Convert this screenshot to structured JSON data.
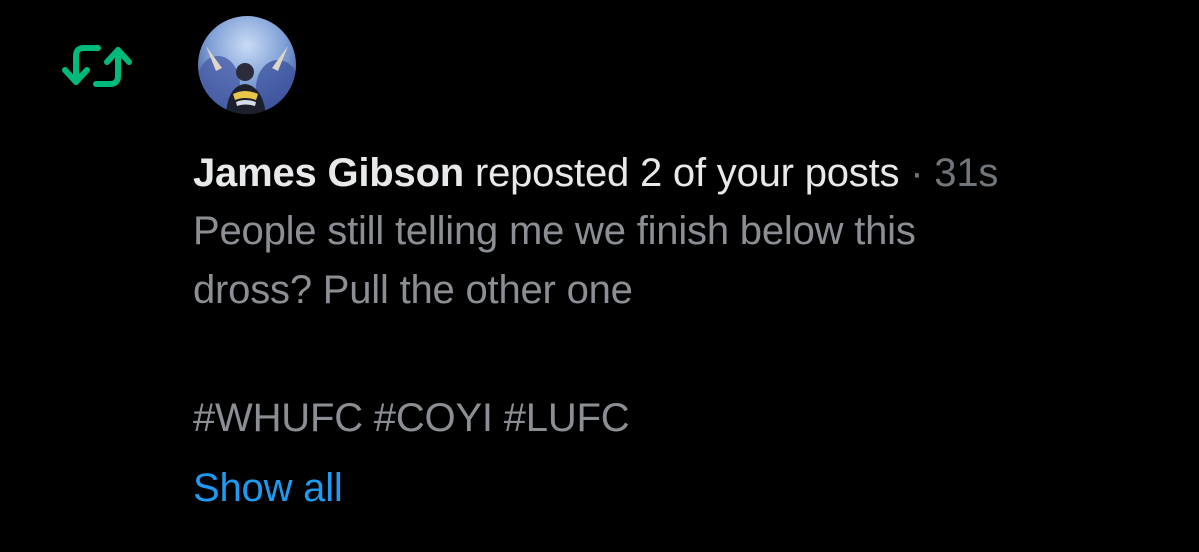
{
  "notification": {
    "type_icon": "repost-icon",
    "icon_color": "#00ba7c",
    "avatar_icon": "user-avatar",
    "username": "James Gibson",
    "action": "reposted 2 of your posts",
    "separator": "·",
    "timestamp": "31s",
    "post": {
      "line1": "People still telling me we finish below this",
      "line2": "dross? Pull the other one",
      "hashtags": "#WHUFC #COYI #LUFC"
    },
    "show_all_label": "Show all",
    "link_color": "#1d9bf0"
  }
}
